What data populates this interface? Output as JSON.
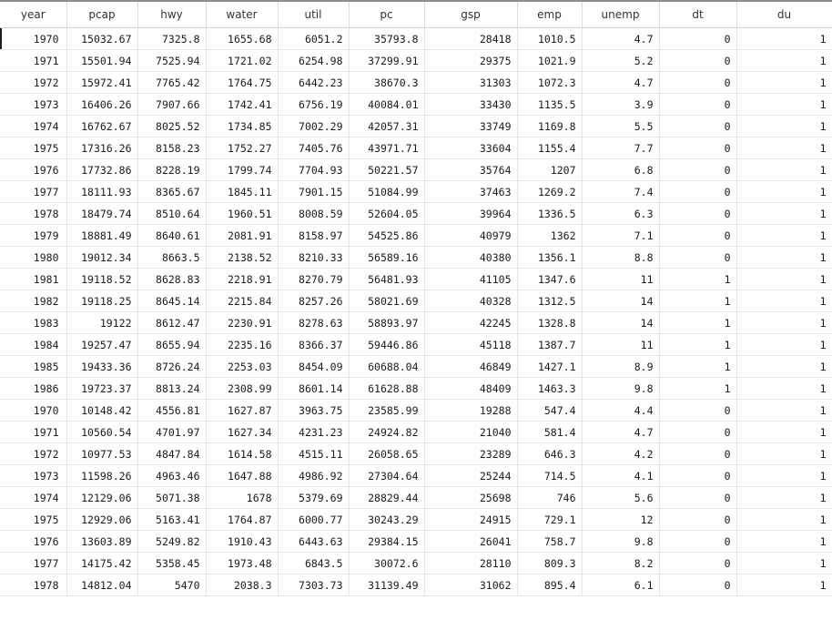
{
  "columns": [
    "year",
    "pcap",
    "hwy",
    "water",
    "util",
    "pc",
    "gsp",
    "emp",
    "unemp",
    "dt",
    "du"
  ],
  "rows": [
    [
      "1970",
      "15032.67",
      "7325.8",
      "1655.68",
      "6051.2",
      "35793.8",
      "28418",
      "1010.5",
      "4.7",
      "0",
      "1"
    ],
    [
      "1971",
      "15501.94",
      "7525.94",
      "1721.02",
      "6254.98",
      "37299.91",
      "29375",
      "1021.9",
      "5.2",
      "0",
      "1"
    ],
    [
      "1972",
      "15972.41",
      "7765.42",
      "1764.75",
      "6442.23",
      "38670.3",
      "31303",
      "1072.3",
      "4.7",
      "0",
      "1"
    ],
    [
      "1973",
      "16406.26",
      "7907.66",
      "1742.41",
      "6756.19",
      "40084.01",
      "33430",
      "1135.5",
      "3.9",
      "0",
      "1"
    ],
    [
      "1974",
      "16762.67",
      "8025.52",
      "1734.85",
      "7002.29",
      "42057.31",
      "33749",
      "1169.8",
      "5.5",
      "0",
      "1"
    ],
    [
      "1975",
      "17316.26",
      "8158.23",
      "1752.27",
      "7405.76",
      "43971.71",
      "33604",
      "1155.4",
      "7.7",
      "0",
      "1"
    ],
    [
      "1976",
      "17732.86",
      "8228.19",
      "1799.74",
      "7704.93",
      "50221.57",
      "35764",
      "1207",
      "6.8",
      "0",
      "1"
    ],
    [
      "1977",
      "18111.93",
      "8365.67",
      "1845.11",
      "7901.15",
      "51084.99",
      "37463",
      "1269.2",
      "7.4",
      "0",
      "1"
    ],
    [
      "1978",
      "18479.74",
      "8510.64",
      "1960.51",
      "8008.59",
      "52604.05",
      "39964",
      "1336.5",
      "6.3",
      "0",
      "1"
    ],
    [
      "1979",
      "18881.49",
      "8640.61",
      "2081.91",
      "8158.97",
      "54525.86",
      "40979",
      "1362",
      "7.1",
      "0",
      "1"
    ],
    [
      "1980",
      "19012.34",
      "8663.5",
      "2138.52",
      "8210.33",
      "56589.16",
      "40380",
      "1356.1",
      "8.8",
      "0",
      "1"
    ],
    [
      "1981",
      "19118.52",
      "8628.83",
      "2218.91",
      "8270.79",
      "56481.93",
      "41105",
      "1347.6",
      "11",
      "1",
      "1"
    ],
    [
      "1982",
      "19118.25",
      "8645.14",
      "2215.84",
      "8257.26",
      "58021.69",
      "40328",
      "1312.5",
      "14",
      "1",
      "1"
    ],
    [
      "1983",
      "19122",
      "8612.47",
      "2230.91",
      "8278.63",
      "58893.97",
      "42245",
      "1328.8",
      "14",
      "1",
      "1"
    ],
    [
      "1984",
      "19257.47",
      "8655.94",
      "2235.16",
      "8366.37",
      "59446.86",
      "45118",
      "1387.7",
      "11",
      "1",
      "1"
    ],
    [
      "1985",
      "19433.36",
      "8726.24",
      "2253.03",
      "8454.09",
      "60688.04",
      "46849",
      "1427.1",
      "8.9",
      "1",
      "1"
    ],
    [
      "1986",
      "19723.37",
      "8813.24",
      "2308.99",
      "8601.14",
      "61628.88",
      "48409",
      "1463.3",
      "9.8",
      "1",
      "1"
    ],
    [
      "1970",
      "10148.42",
      "4556.81",
      "1627.87",
      "3963.75",
      "23585.99",
      "19288",
      "547.4",
      "4.4",
      "0",
      "1"
    ],
    [
      "1971",
      "10560.54",
      "4701.97",
      "1627.34",
      "4231.23",
      "24924.82",
      "21040",
      "581.4",
      "4.7",
      "0",
      "1"
    ],
    [
      "1972",
      "10977.53",
      "4847.84",
      "1614.58",
      "4515.11",
      "26058.65",
      "23289",
      "646.3",
      "4.2",
      "0",
      "1"
    ],
    [
      "1973",
      "11598.26",
      "4963.46",
      "1647.88",
      "4986.92",
      "27304.64",
      "25244",
      "714.5",
      "4.1",
      "0",
      "1"
    ],
    [
      "1974",
      "12129.06",
      "5071.38",
      "1678",
      "5379.69",
      "28829.44",
      "25698",
      "746",
      "5.6",
      "0",
      "1"
    ],
    [
      "1975",
      "12929.06",
      "5163.41",
      "1764.87",
      "6000.77",
      "30243.29",
      "24915",
      "729.1",
      "12",
      "0",
      "1"
    ],
    [
      "1976",
      "13603.89",
      "5249.82",
      "1910.43",
      "6443.63",
      "29384.15",
      "26041",
      "758.7",
      "9.8",
      "0",
      "1"
    ],
    [
      "1977",
      "14175.42",
      "5358.45",
      "1973.48",
      "6843.5",
      "30072.6",
      "28110",
      "809.3",
      "8.2",
      "0",
      "1"
    ],
    [
      "1978",
      "14812.04",
      "5470",
      "2038.3",
      "7303.73",
      "31139.49",
      "31062",
      "895.4",
      "6.1",
      "0",
      "1"
    ]
  ]
}
